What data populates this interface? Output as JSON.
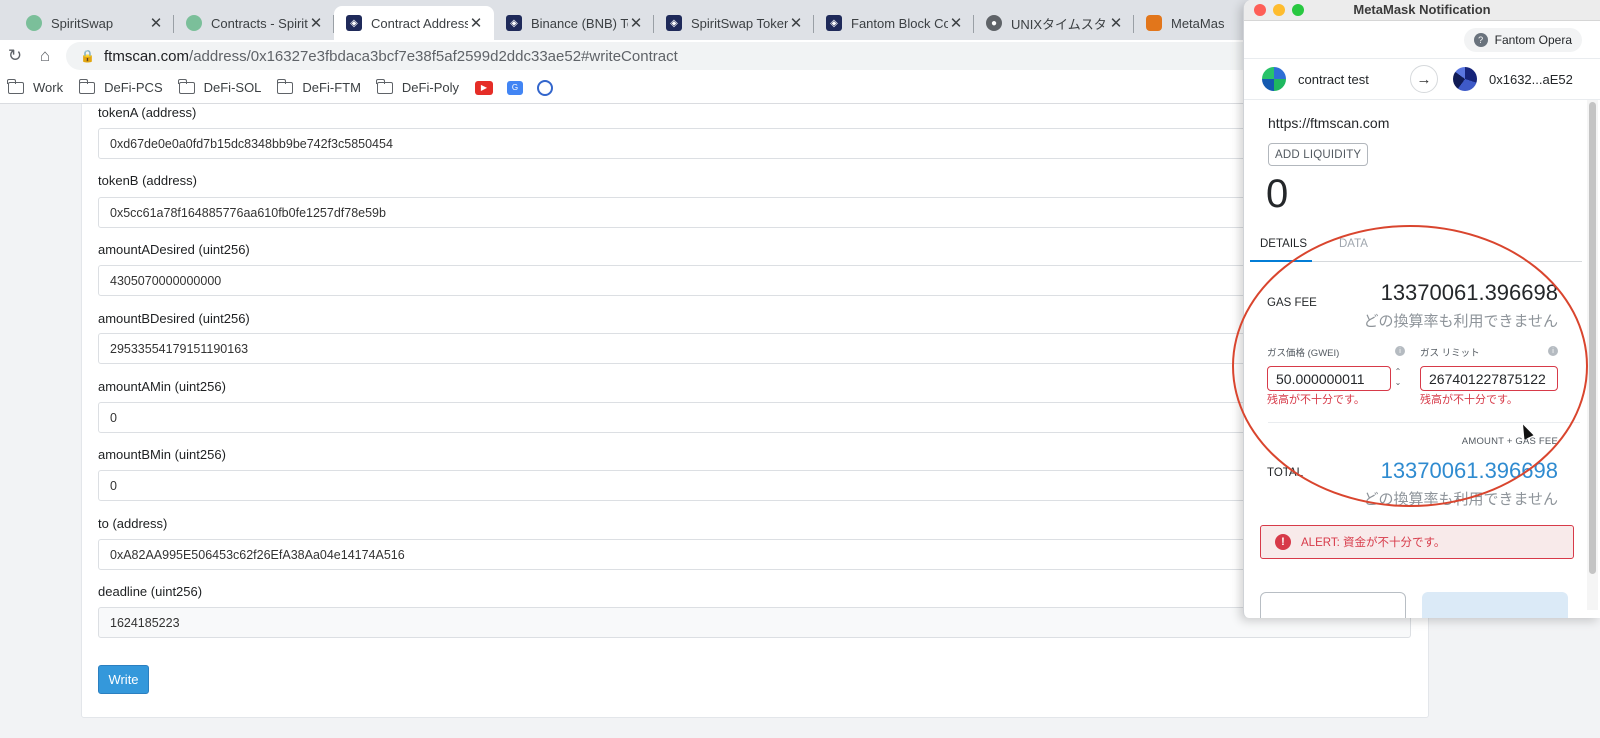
{
  "browser": {
    "tabs": [
      {
        "title": "SpiritSwap",
        "icon": "spirit-icon"
      },
      {
        "title": "Contracts - Spirit",
        "icon": "spirit-icon"
      },
      {
        "title": "Contract Address",
        "icon": "cube-icon",
        "active": true
      },
      {
        "title": "Binance (BNB) To",
        "icon": "cube-icon"
      },
      {
        "title": "SpiritSwap Token",
        "icon": "cube-icon"
      },
      {
        "title": "Fantom Block Co",
        "icon": "cube-icon"
      },
      {
        "title": "UNIXタイムスタン",
        "icon": "globe-icon"
      },
      {
        "title": "MetaMas",
        "icon": "fox-icon"
      }
    ],
    "url": {
      "host": "ftmscan.com",
      "path": "/address/0x16327e3fbdaca3bcf7e38f5af2599d2ddc33ae52#writeContract"
    },
    "bookmarks": [
      "Work",
      "DeFi-PCS",
      "DeFi-SOL",
      "DeFi-FTM",
      "DeFi-Poly"
    ]
  },
  "form": {
    "fields": [
      {
        "label": "tokenA (address)",
        "value": "0xd67de0e0a0fd7b15dc8348bb9be742f3c5850454"
      },
      {
        "label": "tokenB (address)",
        "value": "0x5cc61a78f164885776aa610fb0fe1257df78e59b"
      },
      {
        "label": "amountADesired (uint256)",
        "value": "4305070000000000"
      },
      {
        "label": "amountBDesired (uint256)",
        "value": "29533554179151190163"
      },
      {
        "label": "amountAMin (uint256)",
        "value": "0"
      },
      {
        "label": "amountBMin (uint256)",
        "value": "0"
      },
      {
        "label": "to (address)",
        "value": "0xA82AA995E506453c62f26EfA38Aa04e14174A516"
      },
      {
        "label": "deadline (uint256)",
        "value": "1624185223"
      }
    ],
    "write_label": "Write"
  },
  "metamask": {
    "window_title": "MetaMask Notification",
    "network": "Fantom Opera",
    "from_account": "contract test",
    "to_account": "0x1632...aE52",
    "origin": "https://ftmscan.com",
    "method": "ADD LIQUIDITY",
    "amount": "0",
    "tabs": {
      "details": "DETAILS",
      "data": "DATA"
    },
    "gas_fee": {
      "label": "GAS FEE",
      "value": "13370061.396698",
      "sub": "どの換算率も利用できません"
    },
    "gas_price": {
      "label": "ガス価格 (GWEI)",
      "value": "50.000000011",
      "error": "残高が不十分です。"
    },
    "gas_limit": {
      "label": "ガス リミット",
      "value": "267401227875122",
      "error": "残高が不十分です。"
    },
    "amount_gas_label": "AMOUNT + GAS FEE",
    "total": {
      "label": "TOTAL",
      "value": "13370061.396698",
      "sub": "どの換算率も利用できません"
    },
    "alert": "ALERT: 資金が不十分です。"
  }
}
